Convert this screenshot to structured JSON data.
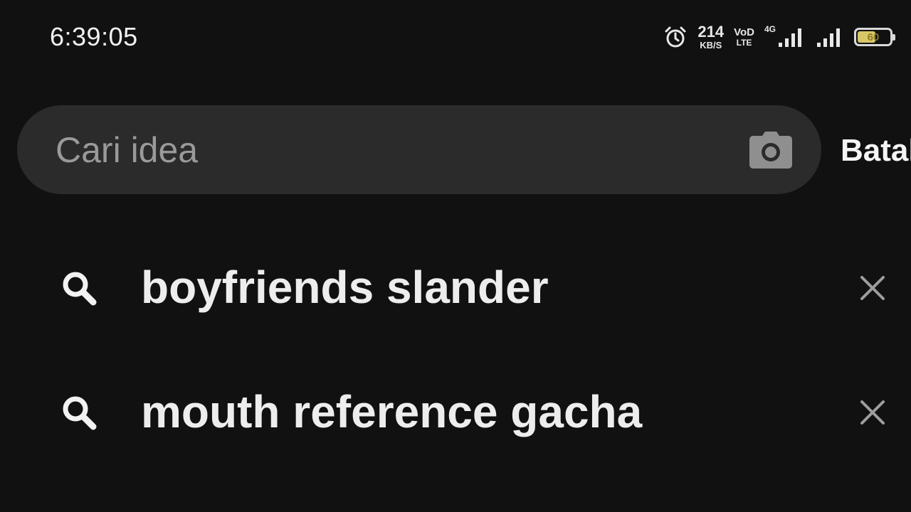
{
  "status_bar": {
    "time": "6:39:05",
    "net_speed_value": "214",
    "net_speed_unit": "KB/S",
    "volte_top": "VoD",
    "volte_bottom": "LTE",
    "network_type": "4G",
    "battery_level": "60",
    "icons": [
      "alarm-icon",
      "signal-strength-icon",
      "signal-strength-icon",
      "battery-icon"
    ]
  },
  "search": {
    "placeholder": "Cari idea",
    "value": "",
    "camera_icon": "camera-icon",
    "cancel_label": "Batal"
  },
  "recent_searches": [
    {
      "label": "boyfriends slander",
      "icon": "search-icon",
      "remove_icon": "close-icon"
    },
    {
      "label": "mouth reference gacha",
      "icon": "search-icon",
      "remove_icon": "close-icon"
    }
  ],
  "colors": {
    "background": "#111111",
    "search_bar": "#2b2b2b",
    "text": "#ededed",
    "placeholder": "#9a9a9a",
    "battery_fill": "#d8c766"
  }
}
